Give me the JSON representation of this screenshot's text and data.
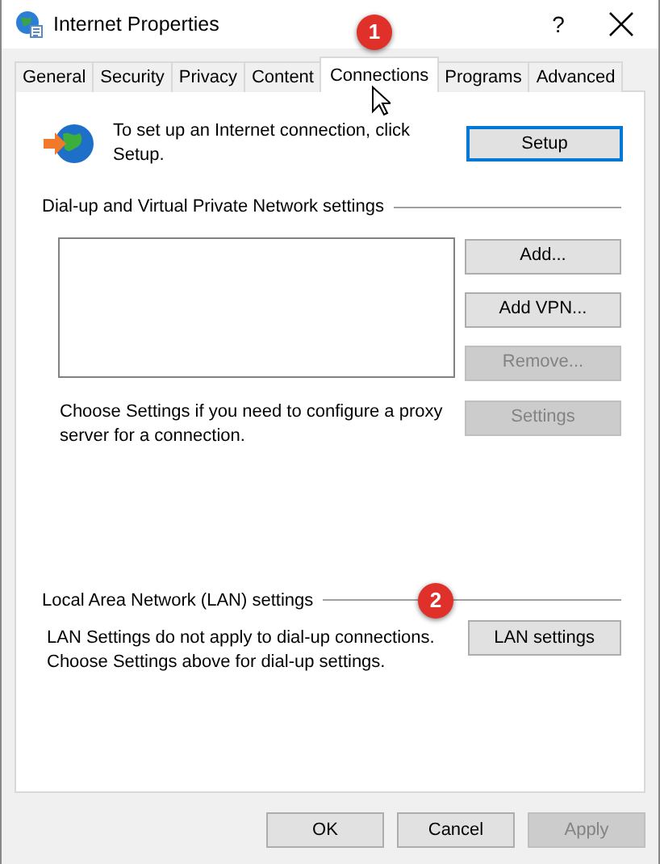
{
  "window": {
    "title": "Internet Properties",
    "help": "?"
  },
  "tabs": [
    {
      "label": "General",
      "selected": false
    },
    {
      "label": "Security",
      "selected": false
    },
    {
      "label": "Privacy",
      "selected": false
    },
    {
      "label": "Content",
      "selected": false
    },
    {
      "label": "Connections",
      "selected": true
    },
    {
      "label": "Programs",
      "selected": false
    },
    {
      "label": "Advanced",
      "selected": false
    }
  ],
  "setup": {
    "text": "To set up an Internet connection, click Setup.",
    "button": {
      "label": "Setup",
      "focused": true
    }
  },
  "dialup": {
    "heading": "Dial-up and Virtual Private Network settings",
    "buttons": [
      {
        "label": "Add...",
        "disabled": false
      },
      {
        "label": "Add VPN...",
        "disabled": false
      },
      {
        "label": "Remove...",
        "disabled": true
      }
    ],
    "proxy_text": "Choose Settings if you need to configure a proxy server for a connection.",
    "settings_button": {
      "label": "Settings",
      "disabled": true
    }
  },
  "lan": {
    "heading": "Local Area Network (LAN) settings",
    "text": "LAN Settings do not apply to dial-up connections. Choose Settings above for dial-up settings.",
    "button": {
      "label": "LAN settings",
      "disabled": false
    }
  },
  "footer_buttons": [
    {
      "label": "OK",
      "disabled": false
    },
    {
      "label": "Cancel",
      "disabled": false
    },
    {
      "label": "Apply",
      "disabled": true
    }
  ],
  "annotations": [
    {
      "label": "1"
    },
    {
      "label": "2"
    }
  ]
}
